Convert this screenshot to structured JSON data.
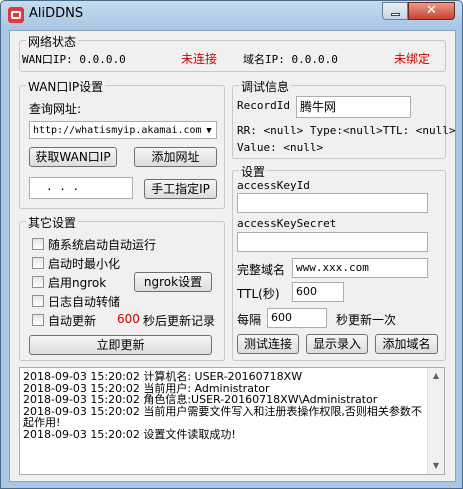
{
  "window": {
    "title": "AliDDNS",
    "close_glyph": "✕"
  },
  "network": {
    "legend": "网络状态",
    "wan_ip_label": "WAN口IP: 0.0.0.0",
    "wan_status": "未连接",
    "domain_ip_label": "域名IP: 0.0.0.0",
    "domain_status": "未绑定"
  },
  "wan": {
    "legend": "WAN口IP设置",
    "query_label": "查询网址:",
    "query_url": "http://whatismyip.akamai.com",
    "get_wan_ip_button": "获取WAN口IP",
    "add_url_button": "添加网址",
    "ip_dots": ".     .     .",
    "manual_ip_button": "手工指定IP"
  },
  "other": {
    "legend": "其它设置",
    "startup": "随系统启动自动运行",
    "minimize": "启动时最小化",
    "ngrok": "启用ngrok",
    "ngrok_settings_button": "ngrok设置",
    "log_dump": "日志自动转储",
    "auto_update": "自动更新",
    "auto_update_seconds": "600",
    "auto_update_suffix": "秒后更新记录",
    "update_now_button": "立即更新"
  },
  "debug": {
    "legend": "调试信息",
    "record_id_label": "RecordId",
    "record_id_value": "腾牛网",
    "rr_line": "RR: <null> Type:<null>TTL: <null>",
    "value_line": "Value: <null>"
  },
  "settings": {
    "legend": "设置",
    "access_key_id_label": "accessKeyId",
    "access_key_id_value": "",
    "access_key_secret_label": "accessKeySecret",
    "access_key_secret_value": "",
    "domain_label": "完整域名",
    "domain_value": "www.xxx.com",
    "ttl_label": "TTL(秒)",
    "ttl_value": "600",
    "interval_label": "每隔",
    "interval_value": "600",
    "interval_suffix": "秒更新一次",
    "test_connection_button": "测试连接",
    "show_records_button": "显示录入",
    "add_domain_button": "添加域名"
  },
  "log": {
    "lines": [
      "2018-09-03 15:20:02 计算机名: USER-20160718XW",
      "2018-09-03 15:20:02 当前用户: Administrator",
      "2018-09-03 15:20:02 角色信息:USER-20160718XW\\Administrator",
      "2018-09-03 15:20:02 当前用户需要文件写入和注册表操作权限,否则相关参数不起作用!",
      "2018-09-03 15:20:02 设置文件读取成功!"
    ]
  },
  "colors": {
    "status_red": "#d00000",
    "titlebar": "#a9c7e6"
  },
  "icons": {
    "app": "app-icon",
    "minimize": "minimize-icon",
    "close": "close-icon",
    "dropdown": "chevron-down-icon",
    "scroll_up": "scroll-up-icon",
    "scroll_down": "scroll-down-icon"
  }
}
